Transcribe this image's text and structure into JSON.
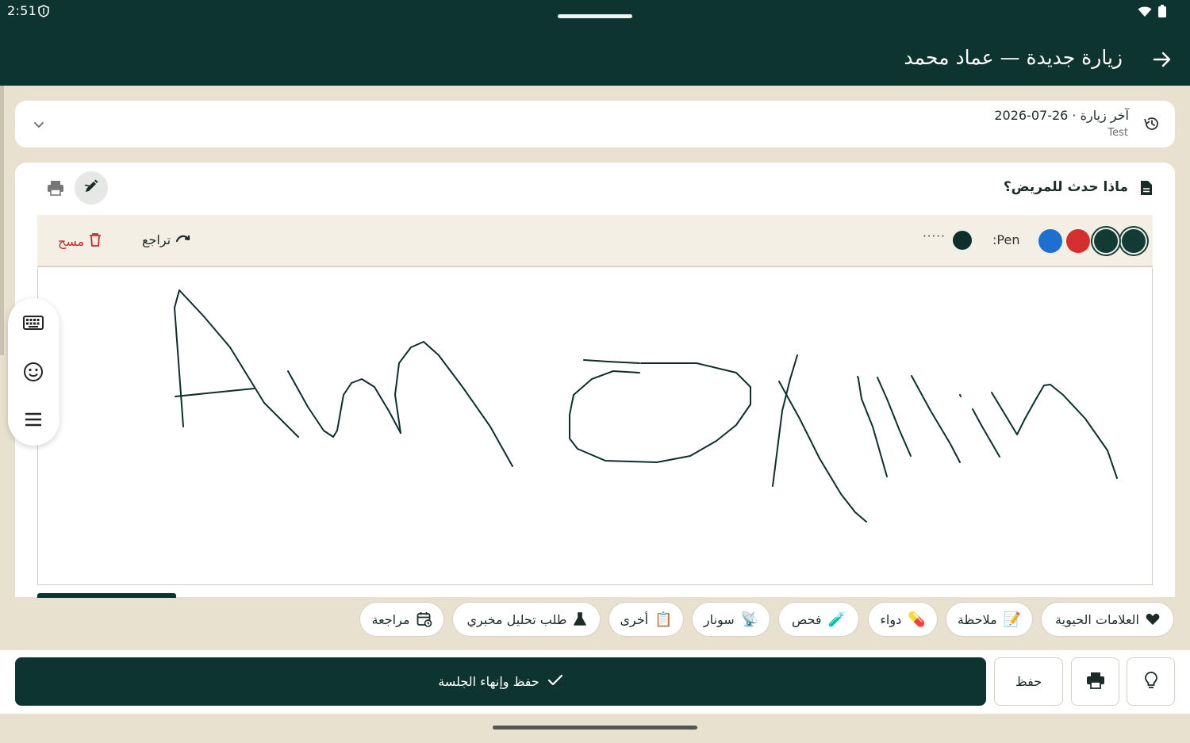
{
  "status": {
    "time": "2:51"
  },
  "header": {
    "title": "زيارة جديدة — عماد محمد",
    "back_icon": "arrow-forward-icon"
  },
  "last_visit": {
    "title": "آخر زيارة · 26-07-2026",
    "subtitle": "Test"
  },
  "notes": {
    "title": "ماذا حدث للمريض؟",
    "pen_label": ":Pen",
    "size_dots": "·····",
    "undo_label": "تراجع",
    "clear_label": "مسح",
    "colors": [
      "#123b36",
      "#123b36",
      "#d32f2f",
      "#1e6fd0"
    ]
  },
  "chips": [
    {
      "label": "العلامات الحيوية",
      "icon": "heart-icon"
    },
    {
      "label": "ملاحظة",
      "icon": "📝"
    },
    {
      "label": "دواء",
      "icon": "💊"
    },
    {
      "label": "فحص",
      "icon": "🧪"
    },
    {
      "label": "سونار",
      "icon": "📡"
    },
    {
      "label": "أخرى",
      "icon": "📋"
    },
    {
      "label": "طلب تحليل مخبري",
      "icon": "flask-icon"
    },
    {
      "label": "مراجعة",
      "icon": "calendar-icon"
    }
  ],
  "actions": {
    "primary_label": "حفظ وإنهاء الجلسة",
    "save_label": "حفظ"
  }
}
